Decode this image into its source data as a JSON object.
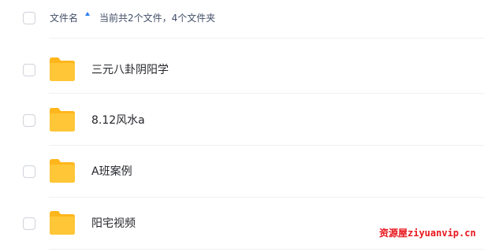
{
  "header": {
    "sort_label": "文件名",
    "summary": "当前共2个文件，4个文件夹",
    "sort_icon": "sort-ascending-arrow-icon"
  },
  "colors": {
    "folder": "#ffc637",
    "folder_back": "#ffb61c",
    "sort_arrow": "#2c7df4",
    "divider": "#eef0f4",
    "watermark": "#e8161c"
  },
  "files": [
    {
      "name": "三元八卦阴阳学",
      "icon": "folder-icon"
    },
    {
      "name": "8.12风水a",
      "icon": "folder-icon"
    },
    {
      "name": "A班案例",
      "icon": "folder-icon"
    },
    {
      "name": "阳宅视频",
      "icon": "folder-icon"
    }
  ],
  "watermark": "资源屋ziyuanvip.cn"
}
